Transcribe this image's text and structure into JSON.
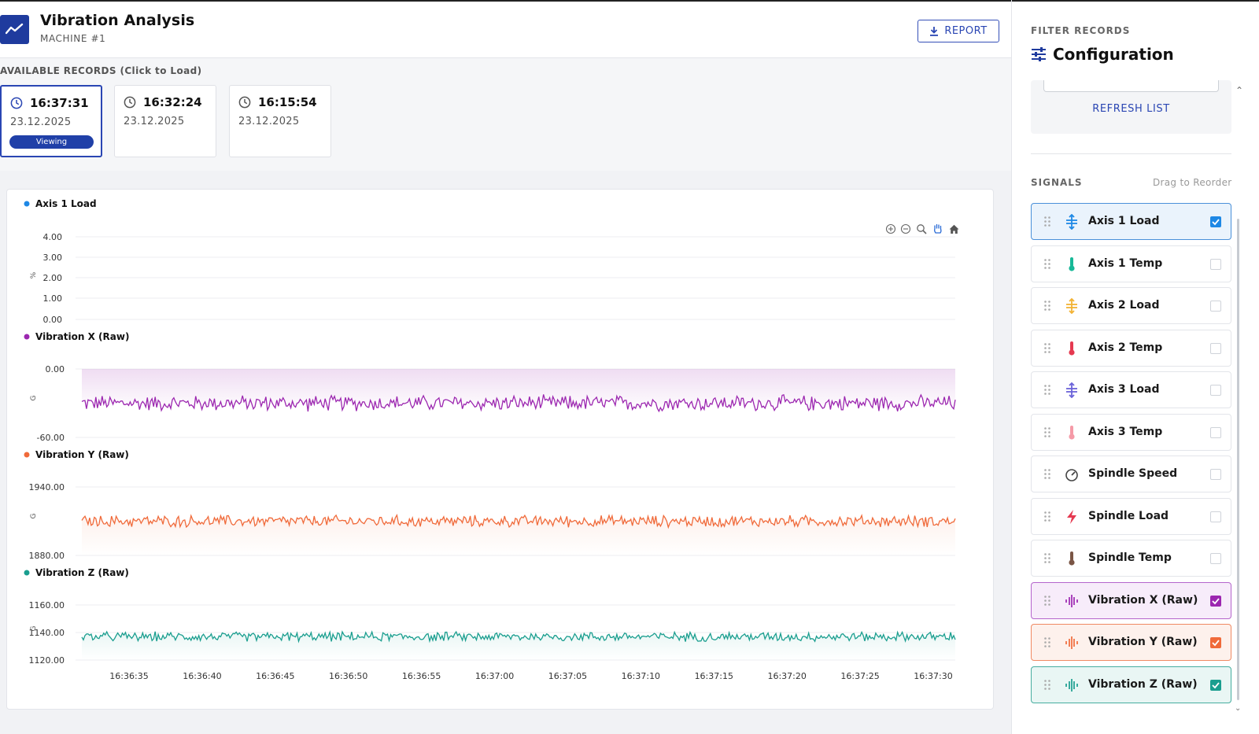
{
  "header": {
    "title": "Vibration Analysis",
    "subtitle": "MACHINE #1",
    "report_label": "REPORT"
  },
  "records": {
    "label": "AVAILABLE RECORDS (Click to Load)",
    "items": [
      {
        "time": "16:37:31",
        "date": "23.12.2025",
        "badge": "Viewing",
        "active": true
      },
      {
        "time": "16:32:24",
        "date": "23.12.2025",
        "badge": "",
        "active": false
      },
      {
        "time": "16:15:54",
        "date": "23.12.2025",
        "badge": "",
        "active": false
      }
    ]
  },
  "chart_data": [
    {
      "type": "line",
      "title": "Axis 1 Load",
      "color": "#1e88e5",
      "ylabel": "%",
      "yticks": [
        "4.00",
        "3.00",
        "2.00",
        "1.00",
        "0.00"
      ],
      "ylim": [
        0,
        4
      ],
      "values_desc": "no data plotted"
    },
    {
      "type": "area",
      "title": "Vibration X (Raw)",
      "color": "#9c27b0",
      "ylabel": "G",
      "yticks": [
        "0.00",
        "-60.00"
      ],
      "ylim": [
        -60,
        0
      ],
      "mean": -30,
      "noise_amplitude": 8
    },
    {
      "type": "area",
      "title": "Vibration Y (Raw)",
      "color": "#f06a3a",
      "ylabel": "G",
      "yticks": [
        "1940.00",
        "1880.00"
      ],
      "ylim": [
        1880,
        1940
      ],
      "mean": 1910,
      "noise_amplitude": 6
    },
    {
      "type": "area",
      "title": "Vibration Z (Raw)",
      "color": "#1a9e8f",
      "ylabel": "G",
      "yticks": [
        "1160.00",
        "1140.00",
        "1120.00"
      ],
      "ylim": [
        1120,
        1160
      ],
      "mean": 1137,
      "noise_amplitude": 4
    }
  ],
  "x_axis": {
    "ticks": [
      "16:36:35",
      "16:36:40",
      "16:36:45",
      "16:36:50",
      "16:36:55",
      "16:37:00",
      "16:37:05",
      "16:37:10",
      "16:37:15",
      "16:37:20",
      "16:37:25",
      "16:37:30"
    ]
  },
  "toolbar_icons": [
    "zoom-in-icon",
    "zoom-out-icon",
    "magnify-icon",
    "pan-hand-icon",
    "home-icon"
  ],
  "panel": {
    "filter_label": "FILTER RECORDS",
    "config_title": "Configuration",
    "refresh_label": "REFRESH LIST",
    "signals_label": "SIGNALS",
    "drag_label": "Drag to Reorder",
    "signals": [
      {
        "label": "Axis 1 Load",
        "icon": "load-icon",
        "color": "#1e88e5",
        "checked": true,
        "bg": "#eaf3fc",
        "border": "#4a90d9"
      },
      {
        "label": "Axis 1 Temp",
        "icon": "thermometer-icon",
        "color": "#17b897",
        "checked": false
      },
      {
        "label": "Axis 2 Load",
        "icon": "load-icon",
        "color": "#f2b233",
        "checked": false
      },
      {
        "label": "Axis 2 Temp",
        "icon": "thermometer-icon",
        "color": "#e53950",
        "checked": false
      },
      {
        "label": "Axis 3 Load",
        "icon": "load-icon",
        "color": "#6b63d9",
        "checked": false
      },
      {
        "label": "Axis 3 Temp",
        "icon": "thermometer-icon",
        "color": "#f59aa7",
        "checked": false
      },
      {
        "label": "Spindle Speed",
        "icon": "gauge-icon",
        "color": "#444444",
        "checked": false
      },
      {
        "label": "Spindle Load",
        "icon": "bolt-icon",
        "color": "#e53950",
        "checked": false
      },
      {
        "label": "Spindle Temp",
        "icon": "thermometer-icon",
        "color": "#7a5545",
        "checked": false
      },
      {
        "label": "Vibration X (Raw)",
        "icon": "waveform-icon",
        "color": "#9c27b0",
        "checked": true,
        "bg": "#f7ecfa",
        "border": "#b565cc"
      },
      {
        "label": "Vibration Y (Raw)",
        "icon": "waveform-icon",
        "color": "#f06a3a",
        "checked": true,
        "bg": "#fdf1ec",
        "border": "#f08a63"
      },
      {
        "label": "Vibration Z (Raw)",
        "icon": "waveform-icon",
        "color": "#1a9e8f",
        "checked": true,
        "bg": "#e9f6f4",
        "border": "#46ad9f"
      }
    ]
  }
}
